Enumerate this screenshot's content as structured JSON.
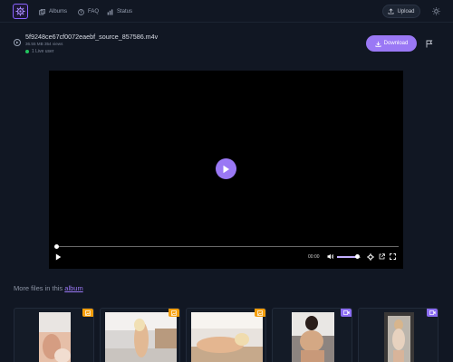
{
  "header": {
    "nav": [
      {
        "label": "Albums",
        "icon": "albums-icon"
      },
      {
        "label": "FAQ",
        "icon": "faq-icon"
      },
      {
        "label": "Status",
        "icon": "status-icon"
      }
    ],
    "upload_label": "Upload"
  },
  "file": {
    "name": "5f9248ce67cf0072eaebf_source_857586.m4v",
    "meta": "36.55 MB 354 views",
    "live": "1 Live user",
    "download_label": "Download"
  },
  "player": {
    "time": "00:00",
    "progress": 0,
    "volume": 0.85
  },
  "more_files": {
    "prefix": "More files in this",
    "link": "album"
  },
  "cards": [
    {
      "badge": "image",
      "badge_color": "#f59e0b"
    },
    {
      "badge": "image",
      "badge_color": "#f59e0b"
    },
    {
      "badge": "image",
      "badge_color": "#f59e0b"
    },
    {
      "badge": "video",
      "badge_color": "#8b6cf2"
    },
    {
      "badge": "video",
      "badge_color": "#8b6cf2"
    }
  ],
  "colors": {
    "background": "#111723",
    "accent": "#9a78f5",
    "image_badge": "#f59e0b",
    "video_badge": "#8b6cf2",
    "live": "#22c55e"
  }
}
